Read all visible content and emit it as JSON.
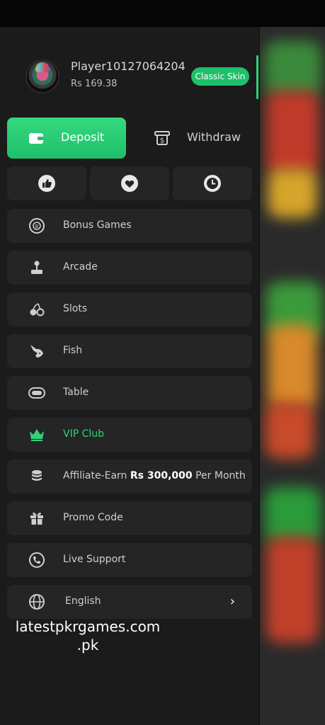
{
  "profile": {
    "username": "Player10127064204",
    "balance": "Rs 169.38",
    "skin_button": "Classic Skin"
  },
  "actions": {
    "deposit": "Deposit",
    "withdraw": "Withdraw"
  },
  "quick_buttons": [
    {
      "icon": "thumbs-up-icon"
    },
    {
      "icon": "heart-icon"
    },
    {
      "icon": "clock-icon"
    }
  ],
  "menu": {
    "bonus_games": "Bonus Games",
    "arcade": "Arcade",
    "slots": "Slots",
    "fish": "Fish",
    "table": "Table",
    "vip_club": "VIP Club",
    "affiliate_prefix": "Affiliate-Earn",
    "affiliate_amount": "Rs 300,000",
    "affiliate_suffix": "Per Month",
    "promo_code": "Promo Code",
    "live_support": "Live Support",
    "language": "English"
  },
  "watermark": {
    "line1": "latestpkrgames.com",
    "line2": ".pk"
  },
  "colors": {
    "accent": "#1fbf6b",
    "drawer_bg": "#1b1b1b",
    "item_bg": "#252525",
    "vip_text": "#2fd27a"
  }
}
